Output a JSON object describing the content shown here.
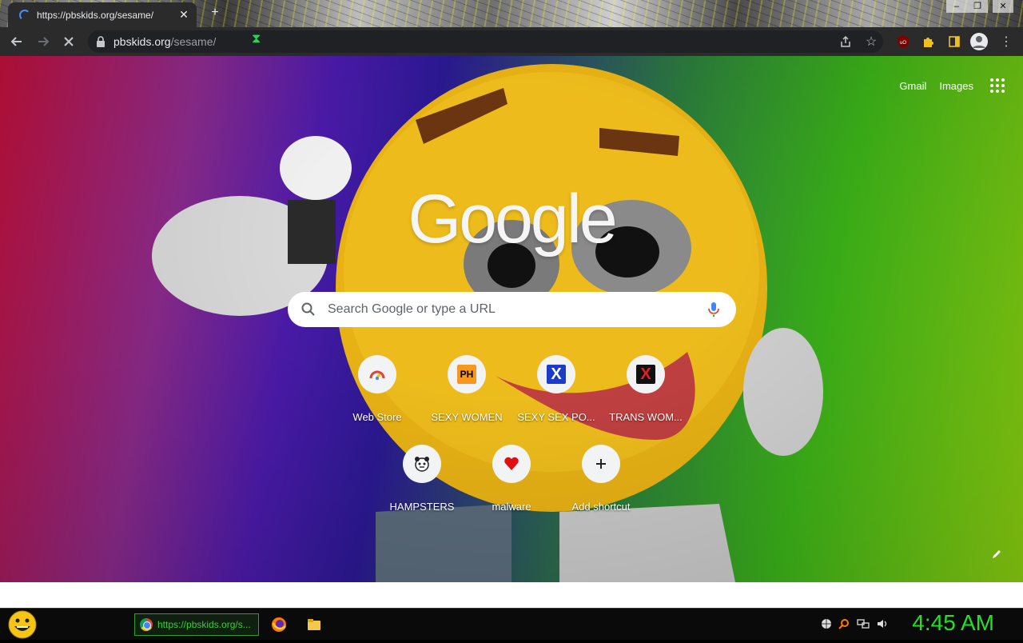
{
  "browser": {
    "tab": {
      "title": "https://pbskids.org/sesame/"
    },
    "address": {
      "host": "pbskids.org",
      "path": "/sesame/"
    }
  },
  "ntp": {
    "links": {
      "gmail": "Gmail",
      "images": "Images"
    },
    "logo": "Google",
    "search": {
      "placeholder": "Search Google or type a URL"
    },
    "shortcuts": [
      {
        "label": "Web Store",
        "icon": "web-store-icon"
      },
      {
        "label": "SEXY WOMEN",
        "icon": "ph-favicon"
      },
      {
        "label": "SEXY SEX PO...",
        "icon": "x-blue-favicon"
      },
      {
        "label": "TRANS WOM...",
        "icon": "x-red-favicon"
      },
      {
        "label": "HAMPSTERS",
        "icon": "hamster-favicon"
      },
      {
        "label": "malware",
        "icon": "heart-favicon"
      },
      {
        "label": "Add shortcut",
        "icon": "plus-icon"
      }
    ],
    "favicon_text": {
      "ph": "PH",
      "x": "X"
    }
  },
  "taskbar": {
    "task_title": "https://pbskids.org/s...",
    "clock": "4:45 AM"
  },
  "colors": {
    "accent_green": "#22e022",
    "chrome_dark": "#2b2b2b",
    "link_blue": "#4285f4"
  }
}
